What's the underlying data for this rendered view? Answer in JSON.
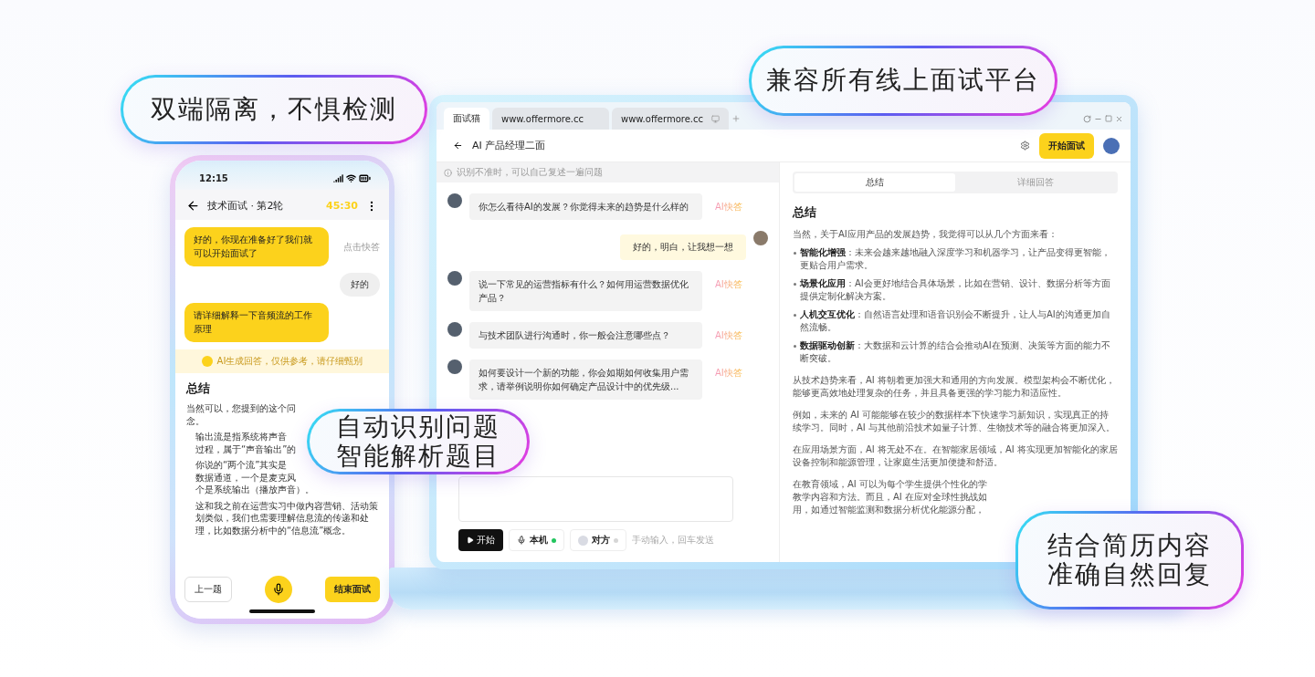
{
  "callouts": [
    {
      "lines": [
        "双端隔离，不惧检测"
      ]
    },
    {
      "lines": [
        "兼容所有线上面试平台"
      ]
    },
    {
      "lines": [
        "自动识别问题",
        "智能解析题目"
      ]
    },
    {
      "lines": [
        "结合简历内容",
        "准确自然回复"
      ]
    }
  ],
  "phone": {
    "time": "12:15",
    "title": "技术面试 · 第2轮",
    "timer": "45:30",
    "messages": [
      {
        "kind": "question",
        "text": "好的，你现在准备好了我们就可以开始面试了",
        "action": "点击快答"
      },
      {
        "kind": "reply",
        "text": "好的"
      },
      {
        "kind": "question",
        "text": "请详细解释一下音频流的工作原理"
      }
    ],
    "notice": "AI生成回答，仅供参考，请仔细甄别",
    "answer": {
      "heading": "总结",
      "intro": [
        "当然可以，您提到的这个问",
        "念。"
      ],
      "points": [
        {
          "lines": [
            "输出流是指系统将声音",
            "过程，属于“声音输出”的"
          ]
        },
        {
          "lines": [
            "你说的“两个流”其实是",
            "数据通道，一个是麦克风",
            "个是系统输出（播放声音）。"
          ]
        },
        {
          "lines": [
            "这和我之前在运营实习中做内容营销、活动策划类似，我们也需要理解信息流的传递和处理，比如数据分析中的“信息流”概念。"
          ]
        }
      ]
    },
    "prev_button": "上一题",
    "end_button": "结束面试"
  },
  "laptop": {
    "tabs": [
      {
        "label": "面试猫",
        "selected": true
      },
      {
        "label": "www.offermore.cc",
        "selected": false
      },
      {
        "label": "www.offermore.cc",
        "selected": false
      }
    ],
    "title": "AI 产品经理二面",
    "start_button": "开始面试",
    "notice": "识别不准时，可以自己复述一遍问题",
    "messages": [
      {
        "kind": "question",
        "text": "你怎么看待AI的发展？你觉得未来的趋势是什么样的",
        "action": "AI快答"
      },
      {
        "kind": "reply",
        "text": "好的，明白，让我想一想"
      },
      {
        "kind": "question",
        "text": "说一下常见的运营指标有什么？如何用运营数据优化产品？",
        "action": "AI快答"
      },
      {
        "kind": "question",
        "text": "与技术团队进行沟通时，你一般会注意哪些点？",
        "action": "AI快答"
      },
      {
        "kind": "question",
        "text": "如何要设计一个新的功能，你会如期如何收集用户需求，请举例说明你如何确定产品设计中的优先级...",
        "action": "AI快答"
      }
    ],
    "controls": [
      {
        "kind": "start",
        "label": "开始"
      },
      {
        "kind": "local",
        "label": "本机",
        "on": true
      },
      {
        "kind": "remote",
        "label": "对方",
        "on": false
      }
    ],
    "hint": "手动输入，回车发送",
    "panel": {
      "tabs": [
        {
          "label": "总结",
          "selected": true
        },
        {
          "label": "详细回答",
          "selected": false
        }
      ],
      "heading": "总结",
      "intro": "当然，关于AI应用产品的发展趋势，我觉得可以从几个方面来看：",
      "bullets": [
        "**智能化增强**：未来会越来越地融入深度学习和机器学习，让产品变得更智能，更贴合用户需求。",
        "**场景化应用**：AI会更好地结合具体场景，比如在营销、设计、数据分析等方面提供定制化解决方案。",
        "**人机交互优化**：自然语言处理和语音识别会不断提升，让人与AI的沟通更加自然流畅。",
        "**数据驱动创新**：大数据和云计算的结合会推动AI在预测、决策等方面的能力不断突破。"
      ],
      "paragraphs": [
        {
          "lines": [
            "从技术趋势来看，AI 将朝着更加强大和通用的方向发展。模型架构会不断优化，能够更高效地处理复杂的任务，并且具备更强的学习能力和适应性。"
          ]
        },
        {
          "lines": [
            "例如，未来的 AI 可能能够在较少的数据样本下快速学习新知识，实现真正的持续学习。同时，AI 与其他前沿技术如量子计算、生物技术等的融合将更加深入。"
          ]
        },
        {
          "lines": [
            "在应用场景方面，AI 将无处不在。在智能家居领域，AI 将实现更加智能化的家居设备控制和能源管理，让家庭生活更加便捷和舒适。"
          ]
        },
        {
          "lines": [
            "在教育领域，AI 可以为每个学生提供个性化的学",
            "教学内容和方法。而且，AI 在应对全球性挑战如",
            "用，如通过智能监测和数据分析优化能源分配，"
          ]
        }
      ]
    }
  }
}
